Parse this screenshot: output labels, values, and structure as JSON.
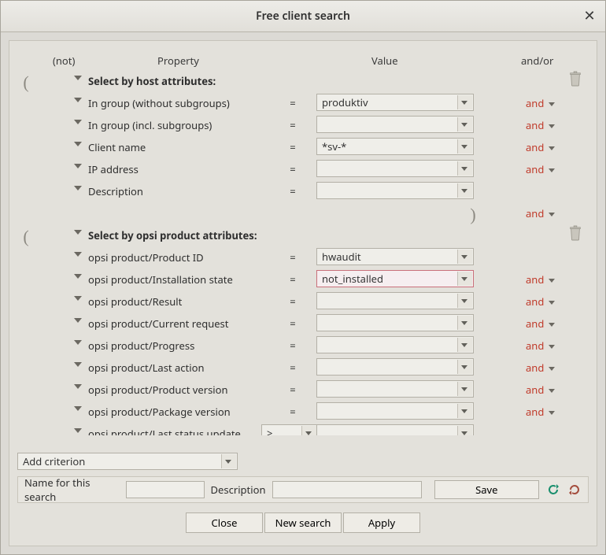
{
  "window": {
    "title": "Free client search"
  },
  "headers": {
    "not": "(not)",
    "property": "Property",
    "value": "Value",
    "andor": "and/or"
  },
  "parens": {
    "open": "(",
    "close": ")"
  },
  "ops": {
    "eq": "=",
    "gt": ">"
  },
  "andor_default": "and",
  "sections": {
    "host": {
      "label": "Select by host attributes:",
      "rows": [
        {
          "id": "in-group-without",
          "prop": "In group (without subgroups)",
          "op": "eq",
          "value": "produktiv",
          "andor": "and"
        },
        {
          "id": "in-group-incl",
          "prop": "In group (incl. subgroups)",
          "op": "eq",
          "value": "",
          "andor": "and"
        },
        {
          "id": "client-name",
          "prop": "Client name",
          "op": "eq",
          "value": "*sv-*",
          "andor": "and"
        },
        {
          "id": "ip-address",
          "prop": "IP address",
          "op": "eq",
          "value": "",
          "andor": "and"
        },
        {
          "id": "description",
          "prop": "Description",
          "op": "eq",
          "value": "",
          "andor": ""
        }
      ],
      "closing_andor": "and"
    },
    "opsi": {
      "label": "Select by opsi product attributes:",
      "rows": [
        {
          "id": "product-id",
          "prop": "opsi product/Product ID",
          "op": "eq",
          "value": "hwaudit",
          "andor": "",
          "highlight": false
        },
        {
          "id": "installation-state",
          "prop": "opsi product/Installation state",
          "op": "eq",
          "value": "not_installed",
          "andor": "and",
          "highlight": true
        },
        {
          "id": "result",
          "prop": "opsi product/Result",
          "op": "eq",
          "value": "",
          "andor": "and"
        },
        {
          "id": "current-request",
          "prop": "opsi product/Current request",
          "op": "eq",
          "value": "",
          "andor": "and"
        },
        {
          "id": "progress",
          "prop": "opsi product/Progress",
          "op": "eq",
          "value": "",
          "andor": "and"
        },
        {
          "id": "last-action",
          "prop": "opsi product/Last action",
          "op": "eq",
          "value": "",
          "andor": "and"
        },
        {
          "id": "product-version",
          "prop": "opsi product/Product version",
          "op": "eq",
          "value": "",
          "andor": "and"
        },
        {
          "id": "package-version",
          "prop": "opsi product/Package version",
          "op": "eq",
          "value": "",
          "andor": "and"
        },
        {
          "id": "last-status-update",
          "prop": "opsi product/Last status update",
          "op": "gt",
          "value": "",
          "andor": "",
          "op_selector": true
        }
      ]
    }
  },
  "add_criterion": {
    "label": "Add criterion"
  },
  "bottom": {
    "name_label": "Name for this search",
    "name_value": "",
    "desc_label": "Description",
    "desc_value": "",
    "save": "Save",
    "close": "Close",
    "new_search": "New search",
    "apply": "Apply"
  }
}
